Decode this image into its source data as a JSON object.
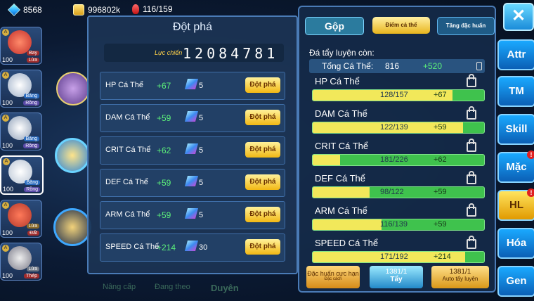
{
  "topbar": {
    "gems": "8568",
    "gold": "996802k",
    "stamina": "116/159"
  },
  "team": [
    {
      "level": "100",
      "element": "Lửa",
      "element2": "Bay",
      "color": "#c4302b"
    },
    {
      "level": "100",
      "element": "Rồng",
      "element2": "Băng",
      "color": "#e8eef5"
    },
    {
      "level": "100",
      "element": "Rồng",
      "element2": "Băng",
      "color": "#d8e0ea"
    },
    {
      "level": "100",
      "element": "Rồng",
      "element2": "Băng",
      "color": "#f0f0f5"
    },
    {
      "level": "100",
      "element": "Đất",
      "element2": "Lửa",
      "color": "#b3382b"
    },
    {
      "level": "100",
      "element": "Thép",
      "element2": "Lửa",
      "color": "#9a9aa5"
    }
  ],
  "break_panel": {
    "title": "Đột phá",
    "power_label": "Lực chiến",
    "power_value": "12084781",
    "button_label": "Đột phá",
    "rows": [
      {
        "stat": "HP Cá Thể",
        "bonus": "+67",
        "count": "5"
      },
      {
        "stat": "DAM Cá Thể",
        "bonus": "+59",
        "count": "5"
      },
      {
        "stat": "CRIT Cá Thể",
        "bonus": "+62",
        "count": "5"
      },
      {
        "stat": "DEF Cá Thể",
        "bonus": "+59",
        "count": "5"
      },
      {
        "stat": "ARM Cá Thể",
        "bonus": "+59",
        "count": "5"
      },
      {
        "stat": "SPEED Cá Thể",
        "bonus": "+214",
        "count": "30"
      }
    ]
  },
  "bottom_tabs": [
    "Nâng cấp",
    "Đang theo",
    "Duyên"
  ],
  "right_panel": {
    "tabs": [
      "Gộp",
      "Điểm cá thể",
      "Tăng đặc huấn"
    ],
    "remaining_label": "Đá tẩy luyện còn:",
    "total": {
      "label": "Tổng Cá Thể:",
      "value": "816",
      "bonus": "+520"
    },
    "stats": [
      {
        "name": "HP Cá Thể",
        "value": "128/157",
        "bonus": "+67",
        "fill": 0.815
      },
      {
        "name": "DAM Cá Thể",
        "value": "122/139",
        "bonus": "+59",
        "fill": 0.878
      },
      {
        "name": "CRIT Cá Thể",
        "value": "181/226",
        "bonus": "+62",
        "fill": 0.16
      },
      {
        "name": "DEF Cá Thể",
        "value": "98/122",
        "bonus": "+59",
        "fill": 0.33
      },
      {
        "name": "ARM Cá Thể",
        "value": "116/139",
        "bonus": "+59",
        "fill": 0.4
      },
      {
        "name": "SPEED Cá Thể",
        "value": "171/192",
        "bonus": "+214",
        "fill": 0.89
      }
    ],
    "buttons": [
      {
        "label": "Đặc huấn cực hạn",
        "sub": "Đặc cách"
      },
      {
        "count": "1381/1",
        "label": "Tẩy"
      },
      {
        "count": "1381/1",
        "label": "Auto tẩy luyện"
      }
    ]
  },
  "side_menu": [
    "Attr",
    "TM",
    "Skill",
    "Mặc",
    "HL",
    "Hóa",
    "Gen"
  ],
  "colors": {
    "accent": "#1aa9ff",
    "gold": "#f2b814",
    "green": "#5cf07a"
  }
}
